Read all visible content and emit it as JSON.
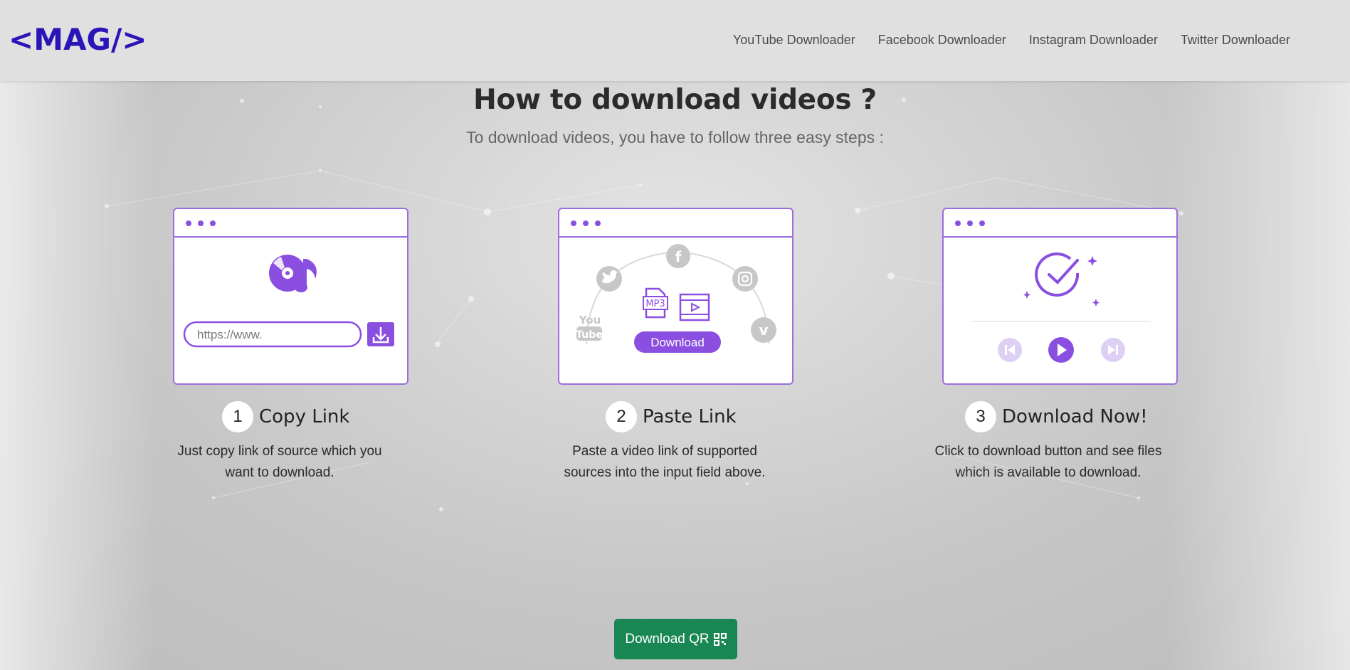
{
  "navbar": {
    "logo_text": "<MAG/>",
    "links": [
      "YouTube Downloader",
      "Facebook Downloader",
      "Instagram Downloader",
      "Twitter Downloader"
    ]
  },
  "section": {
    "title": "How to download videos ?",
    "subtitle": "To download videos, you have to follow three easy steps :"
  },
  "steps": [
    {
      "number": "1",
      "title": "Copy Link",
      "description": "Just copy link of source which you want to download.",
      "url_placeholder": "https://www."
    },
    {
      "number": "2",
      "title": "Paste Link",
      "description": "Paste a video link of supported sources into the input field above.",
      "download_label": "Download",
      "mp3_label": "MP3",
      "youtube_label_1": "You",
      "youtube_label_2": "Tube"
    },
    {
      "number": "3",
      "title": "Download Now!",
      "description": "Click to download button and see files which is available to download."
    }
  ],
  "qr_button": {
    "label": "Download QR"
  },
  "colors": {
    "accent": "#8a4fe0",
    "logo": "#2b14b8",
    "qr_button": "#198754",
    "social_grey": "#c7c7c7"
  }
}
